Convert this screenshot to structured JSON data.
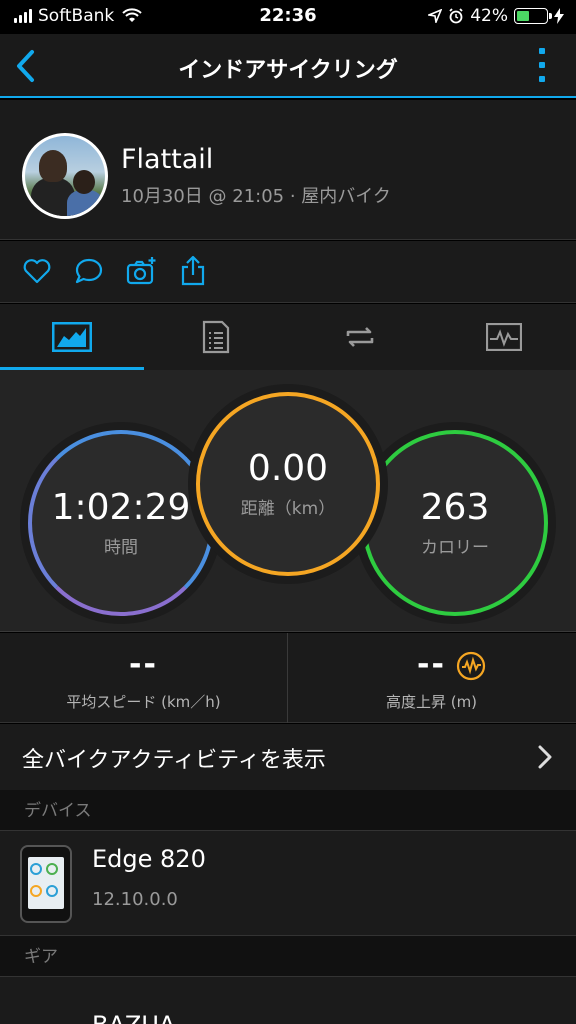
{
  "status": {
    "carrier": "SoftBank",
    "time": "22:36",
    "battery": "42%"
  },
  "nav": {
    "title": "インドアサイクリング"
  },
  "profile": {
    "name": "Flattail",
    "meta": "10月30日 @ 21:05 · 屋内バイク"
  },
  "stats": {
    "time": {
      "value": "1:02:29",
      "label": "時間"
    },
    "distance": {
      "value": "0.00",
      "label": "距離（km）"
    },
    "calories": {
      "value": "263",
      "label": "カロリー"
    }
  },
  "metrics": {
    "avg_speed": {
      "value": "--",
      "label": "平均スピード (km／h)"
    },
    "elevation": {
      "value": "--",
      "label": "高度上昇 (m)"
    }
  },
  "all_bike": {
    "label": "全バイクアクティビティを表示"
  },
  "sections": {
    "devices": "デバイス",
    "gear": "ギア"
  },
  "device": {
    "name": "Edge 820",
    "version": "12.10.0.0"
  },
  "gear": {
    "name": "BAZUA"
  },
  "colors": {
    "accent": "#11a9ed",
    "time_ring": "#4a8fe0",
    "distance_ring": "#f5a623",
    "calories_ring": "#2ecc40"
  }
}
